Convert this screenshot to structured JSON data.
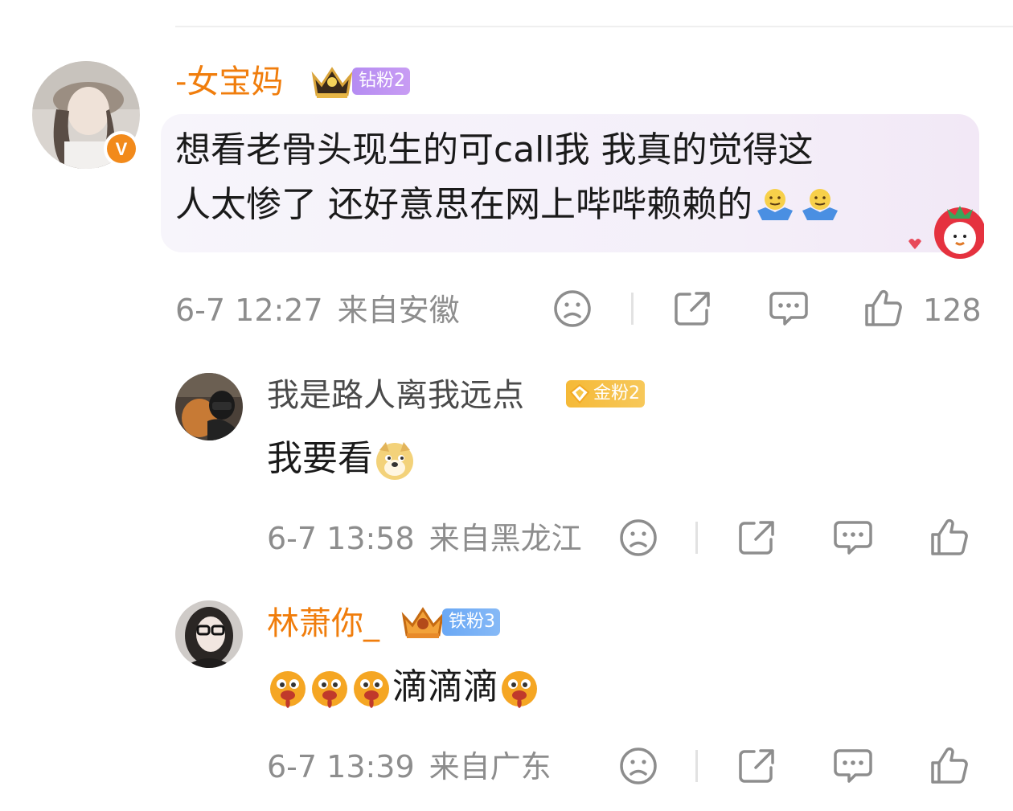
{
  "comments": [
    {
      "username": "-女宝妈",
      "fan_badge": "钻粉2",
      "text_line1": "想看老骨头现生的可call我 我真的觉得这",
      "text_line2": "人太惨了 还好意思在网上哔哔赖赖的",
      "time": "6-7 12:27",
      "location": "来自安徽",
      "likes": "128",
      "verified_badge": "V"
    },
    {
      "username": "我是路人离我远点",
      "fan_badge": "金粉2",
      "text": "我要看",
      "time": "6-7 13:58",
      "location": "来自黑龙江"
    },
    {
      "username": "林萧你_",
      "fan_badge": "铁粉3",
      "text": "滴滴滴",
      "time": "6-7 13:39",
      "location": "来自广东"
    }
  ],
  "icons": {
    "dislike": "sad-face-icon",
    "share": "share-icon",
    "comment": "comment-bubble-icon",
    "like": "thumbs-up-icon"
  },
  "colors": {
    "username_orange": "#f07d0c",
    "meta_gray": "#8d8d8d",
    "badge_purple": "#b58cf2",
    "badge_gold": "#f5b937",
    "badge_blue": "#6aa8f5"
  }
}
